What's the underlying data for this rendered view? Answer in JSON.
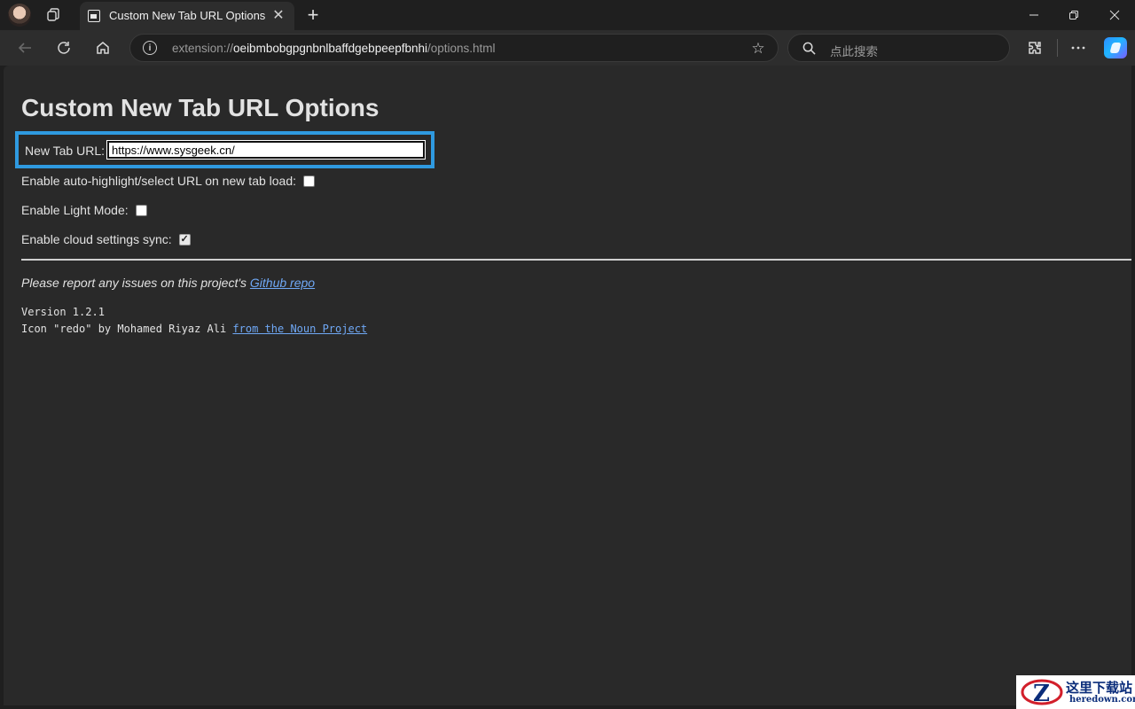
{
  "browser": {
    "tab": {
      "title": "Custom New Tab URL Options"
    },
    "address": {
      "scheme": "extension://",
      "host": "oeibmbobgpgnbnlbaffdgebpeepfbnhi",
      "path": "/options.html"
    },
    "search": {
      "placeholder": "点此搜索"
    },
    "icons": [
      "profile-avatar",
      "workspaces-icon",
      "tab-favicon",
      "close-icon",
      "plus-icon",
      "minimize-icon",
      "restore-icon",
      "close-window-icon",
      "back-icon",
      "refresh-icon",
      "home-icon",
      "info-icon",
      "star-icon",
      "search-icon",
      "extensions-icon",
      "more-icon",
      "copilot-icon"
    ]
  },
  "page": {
    "title": "Custom New Tab URL Options",
    "url_label": "New Tab URL:",
    "url_value": "https://www.sysgeek.cn/",
    "options": [
      {
        "label": "Enable auto-highlight/select URL on new tab load:",
        "checked": false
      },
      {
        "label": "Enable Light Mode:",
        "checked": false
      },
      {
        "label": "Enable cloud settings sync:",
        "checked": true
      }
    ],
    "report_text": "Please report any issues on this project's",
    "report_link": "Github repo",
    "version": "Version 1.2.1",
    "credit_text": "Icon \"redo\" by Mohamed Riyaz Ali",
    "credit_link": "from the Noun Project"
  },
  "watermark": {
    "cn": "这里下载站",
    "en": "heredown.com"
  },
  "colors": {
    "highlight_border": "#2f9ae0",
    "link": "#6fa8f5",
    "page_bg": "#292929"
  }
}
